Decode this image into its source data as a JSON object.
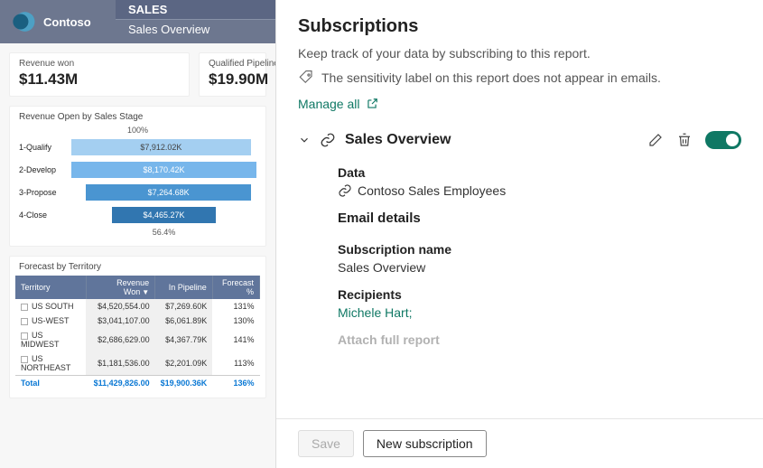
{
  "header": {
    "brand": "Contoso",
    "tab_group": "SALES",
    "tab_page": "Sales Overview"
  },
  "kpis": {
    "revenue_won": {
      "label": "Revenue won",
      "value": "$11.43M"
    },
    "pipeline": {
      "label": "Qualified Pipeline",
      "value": "$19.90M"
    }
  },
  "stage_chart": {
    "title": "Revenue Open by Sales Stage",
    "axis_top": "100%",
    "axis_bottom": "56.4%",
    "rows": [
      {
        "label": "1-Qualify",
        "value": "$7,912.02K"
      },
      {
        "label": "2-Develop",
        "value": "$8,170.42K"
      },
      {
        "label": "3-Propose",
        "value": "$7,264.68K"
      },
      {
        "label": "4-Close",
        "value": "$4,465.27K"
      }
    ]
  },
  "territory_table": {
    "title": "Forecast by Territory",
    "cols": {
      "c0": "Territory",
      "c1": "Revenue Won",
      "c2": "In Pipeline",
      "c3": "Forecast %"
    },
    "rows": [
      {
        "t": "US SOUTH",
        "won": "$4,520,554.00",
        "pipe": "$7,269.60K",
        "f": "131%"
      },
      {
        "t": "US-WEST",
        "won": "$3,041,107.00",
        "pipe": "$6,061.89K",
        "f": "130%"
      },
      {
        "t": "US MIDWEST",
        "won": "$2,686,629.00",
        "pipe": "$4,367.79K",
        "f": "141%"
      },
      {
        "t": "US NORTHEAST",
        "won": "$1,181,536.00",
        "pipe": "$2,201.09K",
        "f": "113%"
      }
    ],
    "total": {
      "t": "Total",
      "won": "$11,429,826.00",
      "pipe": "$19,900.36K",
      "f": "136%"
    }
  },
  "panel": {
    "title": "Subscriptions",
    "subtitle": "Keep track of your data by subscribing to this report.",
    "sensitivity": "The sensitivity label on this report does not appear in emails.",
    "manage": "Manage all",
    "section": {
      "name": "Sales Overview",
      "data_label": "Data",
      "data_value": "Contoso Sales Employees",
      "email_label": "Email details",
      "subname_label": "Subscription name",
      "subname_value": "Sales Overview",
      "recipients_label": "Recipients",
      "recipients_value": "Michele Hart;",
      "attach_label": "Attach full report"
    },
    "footer": {
      "save": "Save",
      "new": "New subscription"
    }
  },
  "chart_data": {
    "type": "bar",
    "title": "Revenue Open by Sales Stage",
    "orientation": "horizontal",
    "categories": [
      "1-Qualify",
      "2-Develop",
      "3-Propose",
      "4-Close"
    ],
    "values": [
      7912.02,
      8170.42,
      7264.68,
      4465.27
    ],
    "unit": "K USD",
    "funnel_top_pct": 100,
    "funnel_bottom_pct": 56.4
  }
}
